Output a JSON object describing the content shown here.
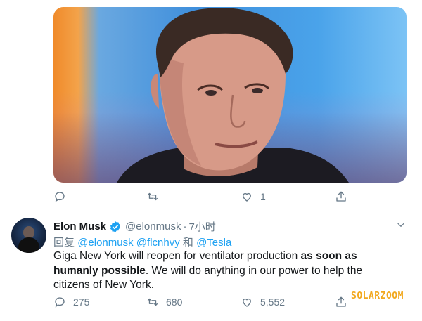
{
  "quoted_tweet": {
    "image": "portrait photo",
    "actions": {
      "reply_count": "",
      "retweet_count": "",
      "like_count": "1"
    }
  },
  "tweet": {
    "author_name": "Elon Musk",
    "handle": "@elonmusk",
    "separator": "·",
    "time": "7小时",
    "reply_prefix": "回复",
    "mentions": [
      "@elonmusk",
      "@flcnhvy",
      "@Tesla"
    ],
    "mention_joiner": "和",
    "text_part1": "Giga New York will reopen for ventilator production ",
    "text_bold": "as soon as humanly possible",
    "text_part2": ". We will do anything in our power to help the citizens of New York.",
    "actions": {
      "reply_count": "275",
      "retweet_count": "680",
      "like_count": "5,552"
    }
  },
  "watermark": "SOLARZOOM",
  "colors": {
    "accent": "#1da1f2",
    "muted": "#657786",
    "text": "#14171a",
    "watermark": "#f2a81d"
  }
}
